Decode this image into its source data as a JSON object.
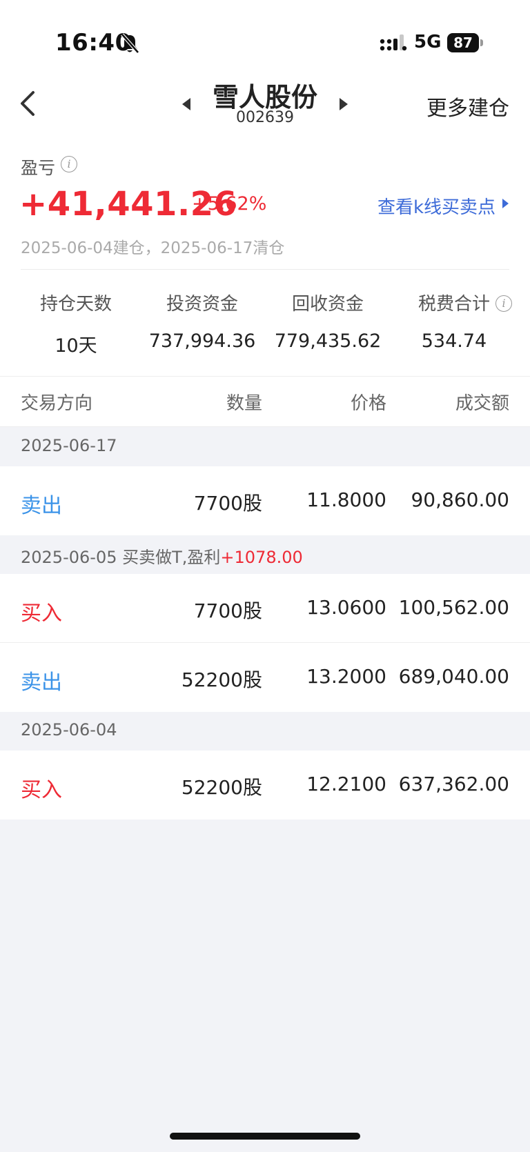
{
  "status_bar": {
    "time": "16:40",
    "network": "5G",
    "battery": "87"
  },
  "nav": {
    "stock_name": "雪人股份",
    "stock_code": "002639",
    "more_label": "更多建仓"
  },
  "summary": {
    "pl_label": "盈亏",
    "pl_value": "+41,441.26",
    "pl_pct": "+5.62%",
    "kline_link": "查看k线买卖点",
    "date_range": "2025-06-04建仓，2025-06-17清仓",
    "stats": [
      {
        "label": "持仓天数",
        "value": "10天"
      },
      {
        "label": "投资资金",
        "value": "737,994.36"
      },
      {
        "label": "回收资金",
        "value": "779,435.62"
      },
      {
        "label": "税费合计",
        "value": "534.74"
      }
    ]
  },
  "table": {
    "headers": {
      "direction": "交易方向",
      "quantity": "数量",
      "price": "价格",
      "amount": "成交额"
    },
    "groups": [
      {
        "date": "2025-06-17",
        "note": "",
        "profit": "",
        "rows": [
          {
            "direction": "卖出",
            "quantity": "7700股",
            "price": "11.8000",
            "amount": "90,860.00"
          }
        ]
      },
      {
        "date": "2025-06-05",
        "note": "买卖做T,盈利",
        "profit": "+1078.00",
        "rows": [
          {
            "direction": "买入",
            "quantity": "7700股",
            "price": "13.0600",
            "amount": "100,562.00"
          },
          {
            "direction": "卖出",
            "quantity": "52200股",
            "price": "13.2000",
            "amount": "689,040.00"
          }
        ]
      },
      {
        "date": "2025-06-04",
        "note": "",
        "profit": "",
        "rows": [
          {
            "direction": "买入",
            "quantity": "52200股",
            "price": "12.2100",
            "amount": "637,362.00"
          }
        ]
      }
    ]
  },
  "colors": {
    "up": "#ee2a35",
    "sell": "#3b93e8",
    "link": "#3d6bd8"
  }
}
